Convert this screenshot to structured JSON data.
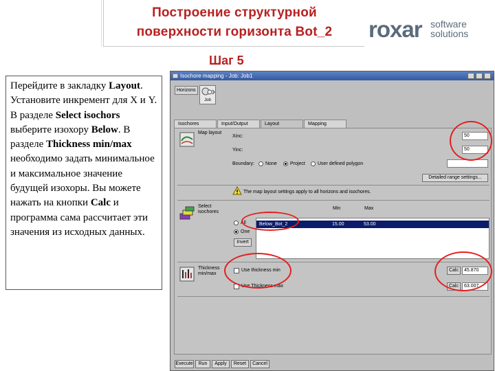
{
  "slide": {
    "title_line1": "Построение структурной",
    "title_line2": "поверхности горизонта Bot_2",
    "step": "Шаг 5",
    "logo": {
      "word": "roxar",
      "sub1": "software",
      "sub2": "solutions"
    },
    "instructions": [
      {
        "t": "Перейдите в закладку ",
        "b": false
      },
      {
        "t": "Layout",
        "b": true
      },
      {
        "t": ". Установите инкремент для X и Y. В разделе ",
        "b": false
      },
      {
        "t": "Select isochors",
        "b": true
      },
      {
        "t": " выберите изохору ",
        "b": false
      },
      {
        "t": "Below",
        "b": true
      },
      {
        "t": ". В разделе ",
        "b": false
      },
      {
        "t": "Thickness min/max",
        "b": true
      },
      {
        "t": " необходимо задать минимальное и максимальное значение будущей изохоры. Вы можете нажать на кнопки ",
        "b": false
      },
      {
        "t": "Calc",
        "b": true
      },
      {
        "t": " и программа сама рассчитает эти значения из исходных данных.",
        "b": false
      }
    ]
  },
  "window": {
    "title": "Isochore mapping - Job: Job1",
    "horizons_label": "Horizons",
    "job_label": "Job",
    "tabs": [
      "Isochores",
      "Input/Output",
      "Layout",
      "Mapping"
    ],
    "active_tab": "Layout",
    "map_layout": {
      "label": "Map layout",
      "xinc_label": "Xinc:",
      "xinc_value": "50",
      "yinc_label": "Yinc:",
      "yinc_value": "50",
      "boundary_label": "Boundary:",
      "boundary_options": [
        "None",
        "Project",
        "User defined polygon"
      ],
      "boundary_selected": "Project",
      "detailed_button": "Detailed range settings..."
    },
    "note": "The map layout settings apply to all horizons and isochores.",
    "select_isochores": {
      "label_line1": "Select",
      "label_line2": "isochores",
      "col_min": "Min",
      "col_max": "Max",
      "all_label": "All",
      "one_label": "One",
      "invert_button": "Invert",
      "rows": [
        {
          "name": "Below_Bot_2",
          "min": "15.00",
          "max": "53.00"
        }
      ]
    },
    "thickness": {
      "label_line1": "Thickness",
      "label_line2": "min/max",
      "use_min_label": "Use thickness min",
      "use_max_label": "Use Thickness max",
      "calc_label": "Calc",
      "min_value": "45.870",
      "max_value": "63.007"
    },
    "bottom_buttons": [
      "Execute",
      "Run",
      "Apply",
      "Reset",
      "Cancel"
    ]
  }
}
